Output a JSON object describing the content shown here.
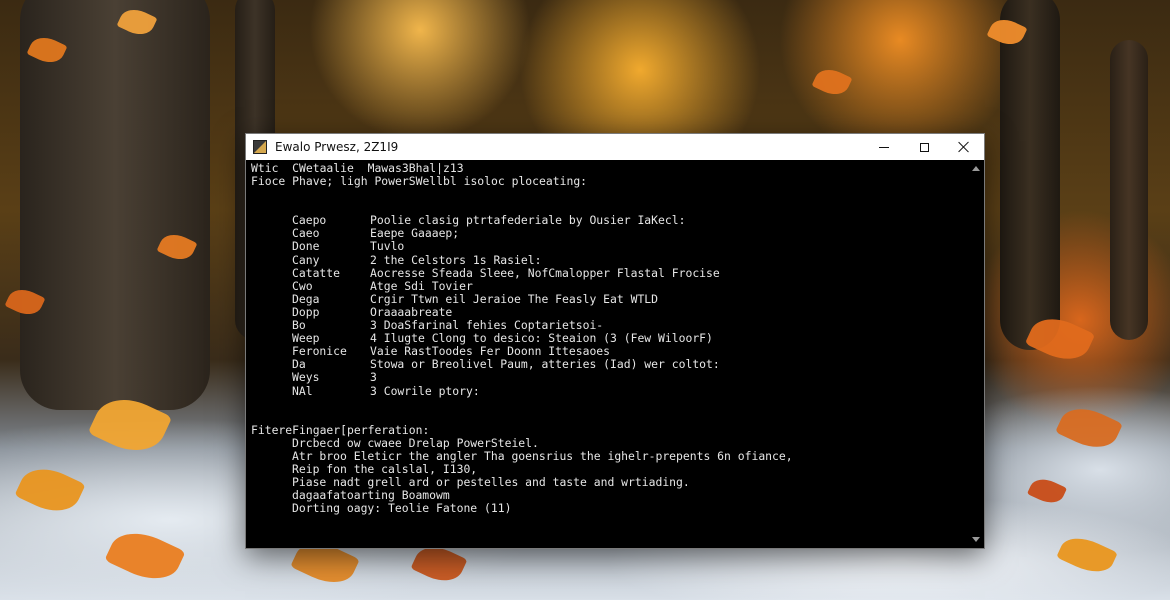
{
  "window": {
    "title": "Ewalo Prwesz, 2Z1I9"
  },
  "console": {
    "header_lines": [
      "Wtic  CWetaalie  Mawas3Bhal|z13",
      "Fioce Phave; ligh PowerSWellbl isoloc ploceating:"
    ],
    "commands": [
      {
        "name": "Caepo",
        "desc": "Poolie clasig ptrtafederiale by Ousier IaKecl:"
      },
      {
        "name": "Caeo",
        "desc": "Eaepe Gaaaep;"
      },
      {
        "name": "Done",
        "desc": "Tuvlo"
      },
      {
        "name": "Cany",
        "desc": "2 the Celstors 1s Rasiel:"
      },
      {
        "name": "Catatte",
        "desc": "Aocresse Sfeada Sleee, NofCmalopper Flastal Frocise"
      },
      {
        "name": "Cwo",
        "desc": "Atge Sdi Tovier"
      },
      {
        "name": "Dega",
        "desc": "Crgir Ttwn eil Jeraioe The Feasly Eat WTLD"
      },
      {
        "name": "Dopp",
        "desc": "Oraaaabreate"
      },
      {
        "name": "Bo",
        "desc": "3 DoaSfarinal fehies Coptarietsoi-"
      },
      {
        "name": "Weep",
        "desc": "4 Ilugte Clong to desico: Steaion (3 (Few WiloorF)"
      },
      {
        "name": "Feronice",
        "desc": "Vaie RastToodes Fer Doonn Ittesaoes"
      },
      {
        "name": "Da",
        "desc": "Stowa or Breolivel Paum, atteries (Iad) wer coltot:"
      },
      {
        "name": "Weys",
        "desc": "3"
      },
      {
        "name": "NAl",
        "desc": "3 Cowrile ptory:"
      }
    ],
    "footer_header": "FitereFingaer[perferation:",
    "footer_lines": [
      "Drcbecd ow cwaee Drelap PowerSteiel.",
      "Atr broo Eleticr the angler Tha goensrius the ighelr-prepents 6n ofiance,",
      "Reip fon the calslal, I130,",
      "Piase nadt grell ard or pestelles and taste and wrtiading.",
      "dagaafatoarting Boamowm",
      "Dorting oagy: Teolie Fatone (11)"
    ]
  }
}
